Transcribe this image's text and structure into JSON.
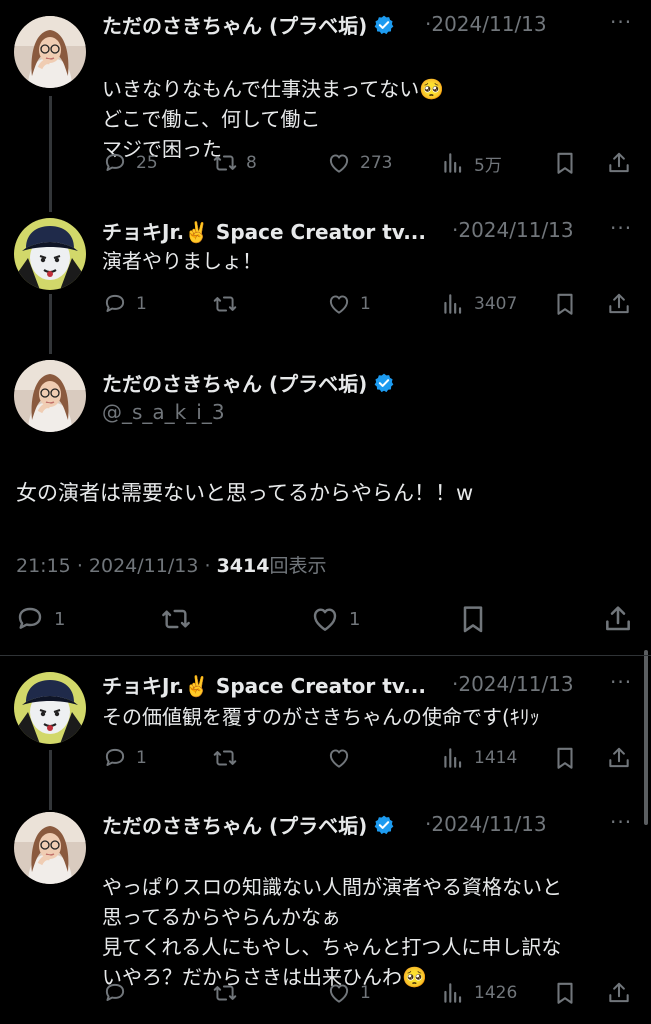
{
  "posts": [
    {
      "name": "ただのさきちゃん (プラベ垢)",
      "sep": "·",
      "date": "2024/11/13",
      "lines": [
        "いきなりなもんで仕事決まってない🥺",
        "どこで働こ、何して働こ",
        "マジで困った"
      ],
      "replies": "25",
      "reposts": "8",
      "likes": "273",
      "views": "5万"
    },
    {
      "name": "チョキJr.✌️ Space Creator tv...",
      "sep": "·",
      "date": "2024/11/13",
      "lines": [
        "演者やりましょ！"
      ],
      "replies": "1",
      "reposts": "",
      "likes": "1",
      "views": "3407"
    },
    {
      "name": "チョキJr.✌️ Space Creator tv...",
      "sep": "·",
      "date": "2024/11/13",
      "lines": [
        "その価値観を覆すのがさきちゃんの使命です(ｷﾘｯ"
      ],
      "replies": "1",
      "reposts": "",
      "likes": "",
      "views": "1414"
    },
    {
      "name": "ただのさきちゃん (プラベ垢)",
      "sep": "·",
      "date": "2024/11/13",
      "lines": [
        "やっぱりスロの知識ない人間が演者やる資格ないと",
        "思ってるからやらんかなぁ",
        "見てくれる人にもやし、ちゃんと打つ人に申し訳な",
        "いやろ？だからさきは出来ひんわ🥺"
      ],
      "replies": "",
      "reposts": "",
      "likes": "1",
      "views": "1426"
    }
  ],
  "focus": {
    "name": "ただのさきちゃん (プラベ垢)",
    "handle": "@_s_a_k_i_3",
    "text": "女の演者は需要ないと思ってるからやらん！！w",
    "time": "21:15",
    "sep1": "·",
    "date": "2024/11/13",
    "sep2": "·",
    "views_count": "3414",
    "views_label": "回表示",
    "replies": "1",
    "reposts": "",
    "likes": "1"
  },
  "icons": {
    "reply": "reply-icon",
    "repost": "repost-icon",
    "like": "like-icon",
    "views": "views-icon",
    "bookmark": "bookmark-icon",
    "share": "share-icon",
    "verified": "verified-badge-icon",
    "more": "more-icon"
  },
  "colors": {
    "background": "#000000",
    "text": "#e7e9ea",
    "muted": "#71767b",
    "verified": "#1d9bf0"
  }
}
